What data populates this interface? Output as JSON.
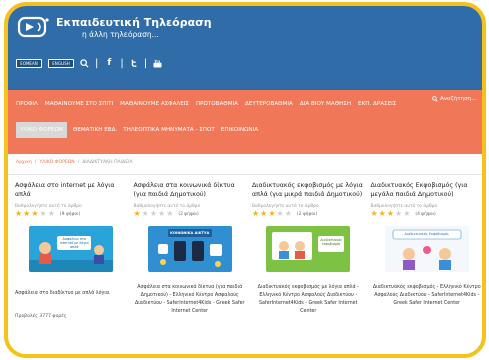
{
  "site": {
    "title": "Εκπαιδευτική Τηλεόραση",
    "subtitle": "η άλλη τηλεόραση..."
  },
  "header": {
    "badges": [
      "EOMEAN",
      "ENGLISH"
    ],
    "social": [
      "search-icon",
      "facebook-icon",
      "twitter-icon",
      "youtube-icon"
    ]
  },
  "nav": {
    "row1": [
      "ΠΡΟΦΙΛ",
      "ΜΑΘΑΙΝΟΥΜΕ ΣΤΟ ΣΠΙΤΙ",
      "ΜΑΘΑΙΝΟΥΜΕ ΑΣΦΑΛΕΙΣ",
      "ΠΡΩΤΟΒΑΘΜΙΑ",
      "ΔΕΥΤΕΡΟΒΑΘΜΙΑ",
      "ΔΙΑ ΒΙΟΥ ΜΑΘΗΣΗ",
      "ΕΚΠ. ΔΡΑΣΕΙΣ"
    ],
    "row2": [
      "ΥΛΙΚΟ ΦΟΡΕΩΝ",
      "ΘΕΜΑΤΙΚΗ ΕΒΔ.",
      "ΤΗΛΕΟΠΤΙΚΑ ΜΗΝΥΜΑΤΑ - ΣΠΟΤ",
      "ΕΠΙΚΟΙΝΩΝΙΑ"
    ],
    "active": "ΥΛΙΚΟ ΦΟΡΕΩΝ",
    "search_placeholder": "Αναζήτηση..."
  },
  "breadcrumb": [
    "Αρχική",
    "ΥΛΙΚΟ ΦΟΡΕΩΝ",
    "ΔΙΑΔΙΚΤΥΑΚΗ ΠΑΙΔΕΙΑ"
  ],
  "cards": [
    {
      "title": "Ασφάλεια στο internet με λόγια απλά",
      "rate_label": "Βαθμολογήστε αυτό το άρθρο",
      "stars": 3,
      "votes": "(9 ψήφοι)",
      "thumb_text": "Ασφάλεια στο internet με λόγια απλά",
      "description": "Ασφάλεια στο διαδίκτυο με απλά λόγια.",
      "views": "Προβολές 3777 φορές"
    },
    {
      "title": "Ασφάλεια στα κοινωνικά δίκτυα (για παιδιά Δημοτικού)",
      "rate_label": "Βαθμολογήστε αυτό το άρθρο",
      "stars": 1,
      "votes": "(2 ψήφοι)",
      "thumb_text": "ΚΟΙΝΩΝΙΚΑ ΔΙΚΤΥΑ",
      "description": "Ασφάλεια στα κοινωνικά δίκτυα (για παιδιά Δημοτικού) - Ελληνικό Κέντρο Ασφαλούς Διαδικτύου - SaferInternet4Kids - Greek Safer Internet Center"
    },
    {
      "title": "Διαδικτυακός εκφοβισμός με λόγια απλά (για μικρά παιδιά Δημοτικού)",
      "rate_label": "Βαθμολογήστε αυτό το άρθρο",
      "stars": 3,
      "votes": "(2 ψήφοι)",
      "thumb_text": "Διαδικτυακός εκφοβισμός",
      "description": "Διαδικτυακός εκφοβισμός με λόγια απλά - Ελληνικό Κέντρο Ασφαλούς Διαδικτύου - SaferInternet4Kids - Greek Safer Internet Center"
    },
    {
      "title": "Διαδικτυακός Εκφοβισμός (για μεγάλα παιδιά Δημοτικού)",
      "rate_label": "Βαθμολογήστε αυτό το άρθρο",
      "stars": 3,
      "votes": "(4 ψήφοι)",
      "thumb_text": "Διαδικτυακός Εκφοβισμός",
      "description": "Διαδικτυακός εκφοβισμός - Ελληνικό Κέντρο Ασφαλούς Διαδικτύου - SaferInternet4Kids - Greek Safer Internet Center"
    }
  ],
  "colors": {
    "frame": "#f4c21b",
    "header": "#2f6ca8",
    "nav": "#f07858",
    "star_on": "#f2b21b"
  }
}
